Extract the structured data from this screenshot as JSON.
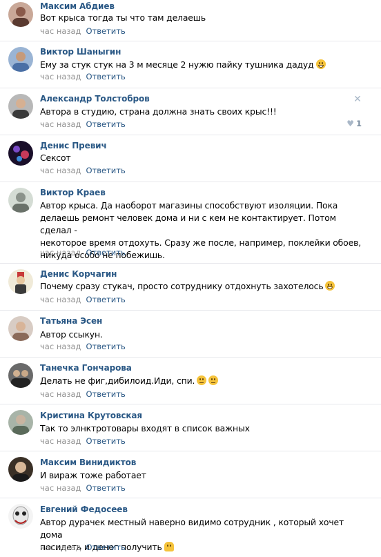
{
  "comments": [
    {
      "author": "Максим Абдиев",
      "text": "Вот крыса тогда ты что там делаешь",
      "time": "час назад",
      "reply": "Ответить",
      "avatar_color": "#8a5a4a"
    },
    {
      "author": "Виктор Шаныгин",
      "text": "Ему за стук стук на 3 м месяце 2 нужю пайку тушника дадуд",
      "emoji": "grin",
      "time": "час назад",
      "reply": "Ответить",
      "avatar_color": "#4a6fa5"
    },
    {
      "author": "Александр Толстобров",
      "text": "Автора в студию, страна должна знать своих крыс!!!",
      "time": "час назад",
      "reply": "Ответить",
      "likes": "1",
      "avatar_color": "#6b6b6b"
    },
    {
      "author": "Денис Превич",
      "text": "Сексот",
      "time": "час назад",
      "reply": "Ответить",
      "avatar_color": "#2a1a3a"
    },
    {
      "author": "Виктор Краев",
      "text": "Автор крыса. Да наоборот магазины способствуют изоляции. Пока\nделаешь ремонт человек дома и ни с кем не контактирует. Потом сделал -\nнекоторое время отдохуть. Сразу же после, например, поклейки обоев,\nникуда особо не побежишь.",
      "time": "час назад",
      "reply": "Ответить",
      "avatar_color": "#9aa29a"
    },
    {
      "author": "Денис Корчагин",
      "text": "Почему сразу стукач, просто сотруднику отдохнуть захотелось",
      "emoji": "grin",
      "time": "час назад",
      "reply": "Ответить",
      "avatar_color": "#d8c9a0"
    },
    {
      "author": "Татьяна Эсен",
      "text": "Автор ссыкун.",
      "time": "час назад",
      "reply": "Ответить",
      "avatar_color": "#b49a8a"
    },
    {
      "author": "Танечка Гончарова",
      "text": "Делать не фиг,дибилоид.Иди, спи.",
      "emoji": "neutral",
      "emoji2": "neutral",
      "time": "час назад",
      "reply": "Ответить",
      "avatar_color": "#3a3a3a"
    },
    {
      "author": "Кристина Крутовская",
      "text": "Так то элнктротовары входят в список важных",
      "time": "час назад",
      "reply": "Ответить",
      "avatar_color": "#8a9a8a"
    },
    {
      "author": "Максим Винидиктов",
      "text": "И вираж тоже работает",
      "time": "час назад",
      "reply": "Ответить",
      "avatar_color": "#5a4a3a"
    },
    {
      "author": "Евгений Федосеев",
      "text": "Автор дурачек местный наверно видимо сотрудник , который хочет дома\nпосидеть и денег получить",
      "emoji": "person",
      "time": "час назад",
      "reply": "Ответить",
      "avatar_color": "#e0e0e0"
    }
  ]
}
